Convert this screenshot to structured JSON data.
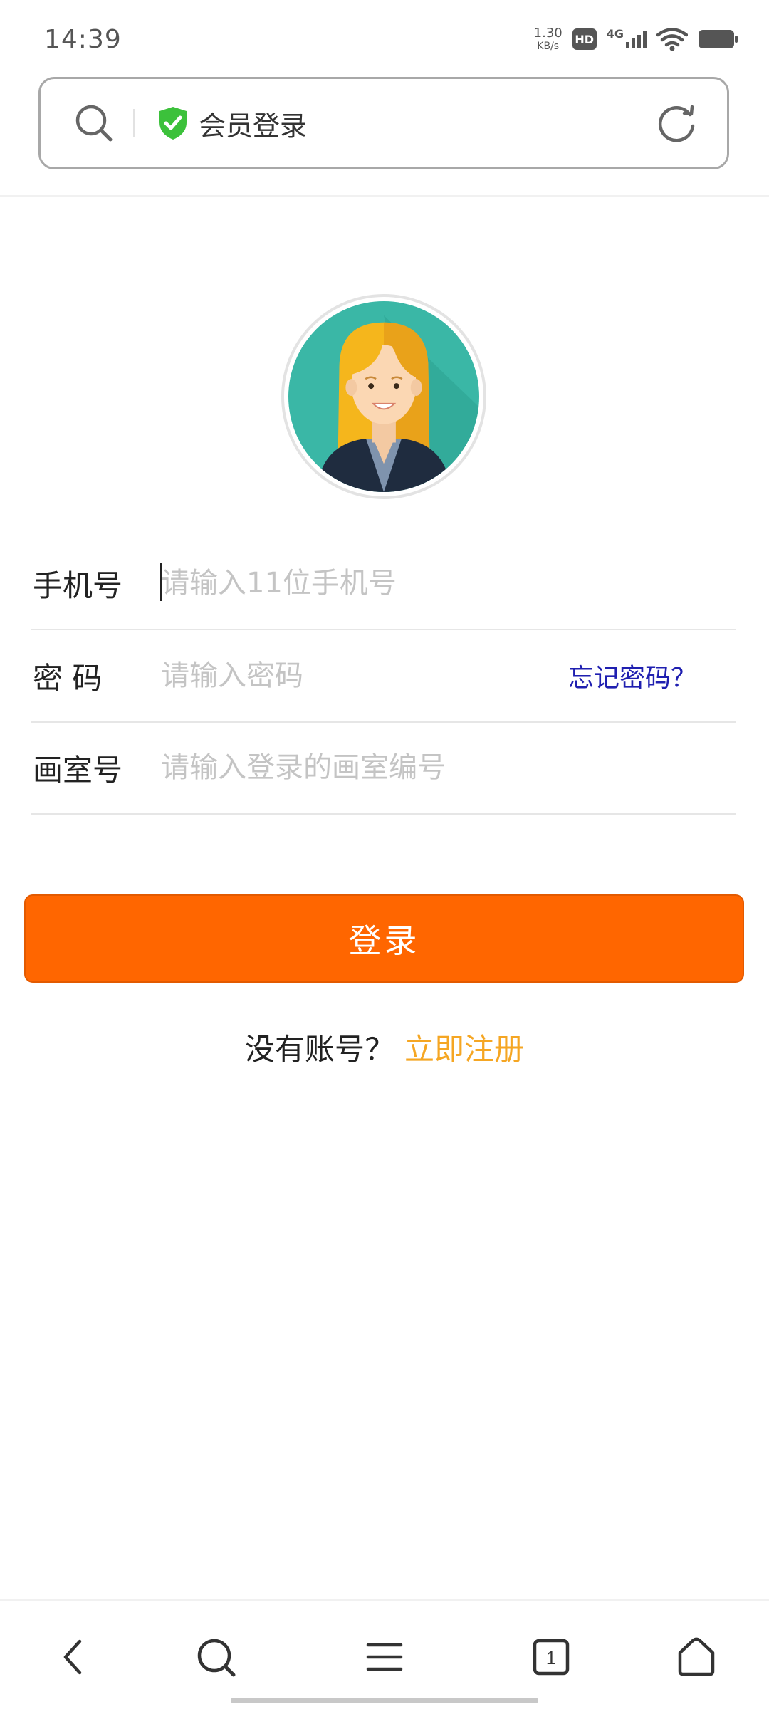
{
  "status_bar": {
    "time": "14:39",
    "net_speed_value": "1.30",
    "net_speed_unit": "KB/s",
    "hd_label": "HD",
    "network_label": "4G"
  },
  "address_bar": {
    "title": "会员登录",
    "shield_color": "#3cc13b"
  },
  "form": {
    "phone": {
      "label": "手机号",
      "placeholder": "请输入11位手机号"
    },
    "password": {
      "label": "密 码",
      "placeholder": "请输入密码",
      "forgot_label": "忘记密码？"
    },
    "studio": {
      "label": "画室号",
      "placeholder": "请输入登录的画室编号"
    }
  },
  "login_button": {
    "label": "登录",
    "color": "#ff6600"
  },
  "register": {
    "question": "没有账号？",
    "action_label": "立即注册",
    "action_color": "#f5a623"
  },
  "bottom_nav": {
    "tab_count": "1",
    "items": [
      "back-icon",
      "search-icon",
      "menu-icon",
      "tabs-icon",
      "home-icon"
    ]
  }
}
